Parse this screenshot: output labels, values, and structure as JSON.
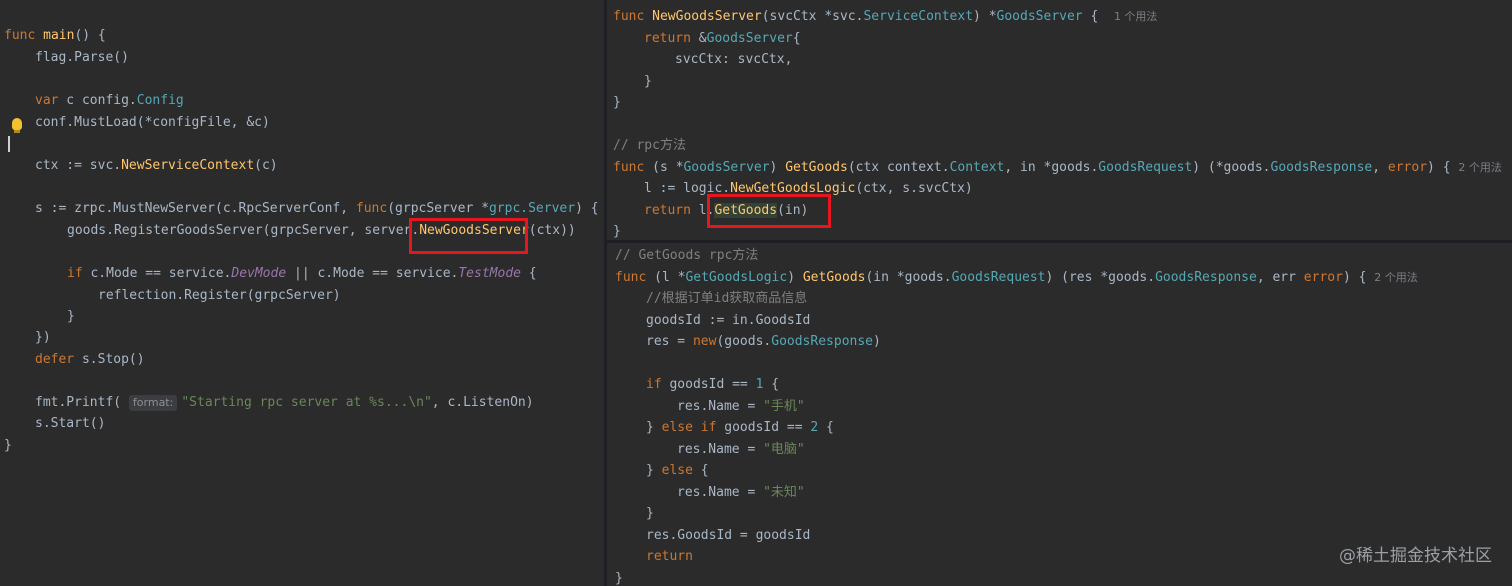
{
  "left": {
    "l1": {
      "kw": "func",
      "name": "main",
      "rest": "() {"
    },
    "l2": "flag.Parse()",
    "l3": {
      "kw": "var",
      "a": " c config.",
      "type": "Config"
    },
    "l4": "conf.MustLoad(*configFile, &c)",
    "l5": {
      "a": "ctx := svc.",
      "fn": "NewServiceContext",
      "b": "(c)"
    },
    "l6": {
      "a": "s := zrpc.MustNewServer(c.RpcServerConf, ",
      "kw": "func",
      "b": "(grpcServer *",
      "typ": "grpc.Server",
      "c": ") {"
    },
    "l7": {
      "a": "goods.RegisterGoodsServer(grpcServer, server.",
      "fn": "NewGoodsServer",
      "b": "(ctx))"
    },
    "l8": {
      "kw": "if",
      "a": " c.Mode == service.",
      "it1": "DevMode",
      "b": " || c.Mode == service.",
      "it2": "TestMode",
      "c": " {"
    },
    "l9": "reflection.Register(grpcServer)",
    "l10": "}",
    "l11": "})",
    "l12": {
      "kw": "defer",
      "a": " s.Stop()"
    },
    "l13": {
      "a": "fmt.Printf( ",
      "hint": "format:",
      "str": "\"Starting rpc server at %s...\\n\"",
      "b": ", c.ListenOn)"
    },
    "l14": "s.Start()",
    "l15": "}"
  },
  "topright": {
    "l1": {
      "kw": "func",
      "fn": "NewGoodsServer",
      "a": "(svcCtx *svc.",
      "typ": "ServiceContext",
      "b": ") *",
      "typ2": "GoodsServer",
      "c": " {",
      "uses": "1 个用法"
    },
    "l2": {
      "kw": "return",
      "a": " &",
      "typ": "GoodsServer",
      "b": "{"
    },
    "l3": "svcCtx: svcCtx,",
    "l4": "}",
    "l5": "}",
    "l6": "// rpc方法",
    "l7": {
      "kw": "func",
      "a": " (s *",
      "typ": "GoodsServer",
      "b": ") ",
      "fn": "GetGoods",
      "c": "(ctx context.",
      "typ2": "Context",
      "d": ", in *goods.",
      "typ3": "GoodsRequest",
      "e": ") (*goods.",
      "typ4": "GoodsResponse",
      "f": ", ",
      "kw2": "error",
      "g": ") {",
      "uses": "2 个用法"
    },
    "l8": {
      "a": "l := logic.",
      "fn": "NewGetGoodsLogic",
      "b": "(ctx, s.svcCtx)"
    },
    "l9": {
      "kw": "return",
      "a": " l.",
      "fn": "GetGoods",
      "b": "(in)"
    },
    "l10": "}"
  },
  "bottomright": {
    "l1": "// GetGoods rpc方法",
    "l2": {
      "kw": "func",
      "a": " (l *",
      "typ": "GetGoodsLogic",
      "b": ") ",
      "fn": "GetGoods",
      "c": "(in *goods.",
      "typ2": "GoodsRequest",
      "d": ") (res *goods.",
      "typ3": "GoodsResponse",
      "e": ", err ",
      "kw2": "error",
      "f": ") {",
      "uses": "2 个用法"
    },
    "l3": "//根据订单id获取商品信息",
    "l4": "goodsId := in.GoodsId",
    "l5": {
      "a": "res = ",
      "kw": "new",
      "b": "(goods.",
      "typ": "GoodsResponse",
      "c": ")"
    },
    "l6": {
      "kw": "if",
      "a": " goodsId == ",
      "num": "1",
      "b": " {"
    },
    "l7": {
      "a": "res.Name = ",
      "str": "\"手机\""
    },
    "l8": {
      "a": "} ",
      "kw": "else if",
      "b": " goodsId == ",
      "num": "2",
      "c": " {"
    },
    "l9": {
      "a": "res.Name = ",
      "str": "\"电脑\""
    },
    "l10": {
      "a": "} ",
      "kw": "else",
      "b": " {"
    },
    "l11": {
      "a": "res.Name = ",
      "str": "\"未知\""
    },
    "l12": "}",
    "l13": "res.GoodsId = goodsId",
    "l14": {
      "kw": "return"
    },
    "l15": "}"
  },
  "watermark": "@稀土掘金技术社区",
  "colors": {
    "keyword": "#cc7832",
    "function": "#ffc66d",
    "type": "#56a8b5",
    "string": "#6a8759",
    "comment": "#808080",
    "highlight_box": "#e5161d"
  }
}
